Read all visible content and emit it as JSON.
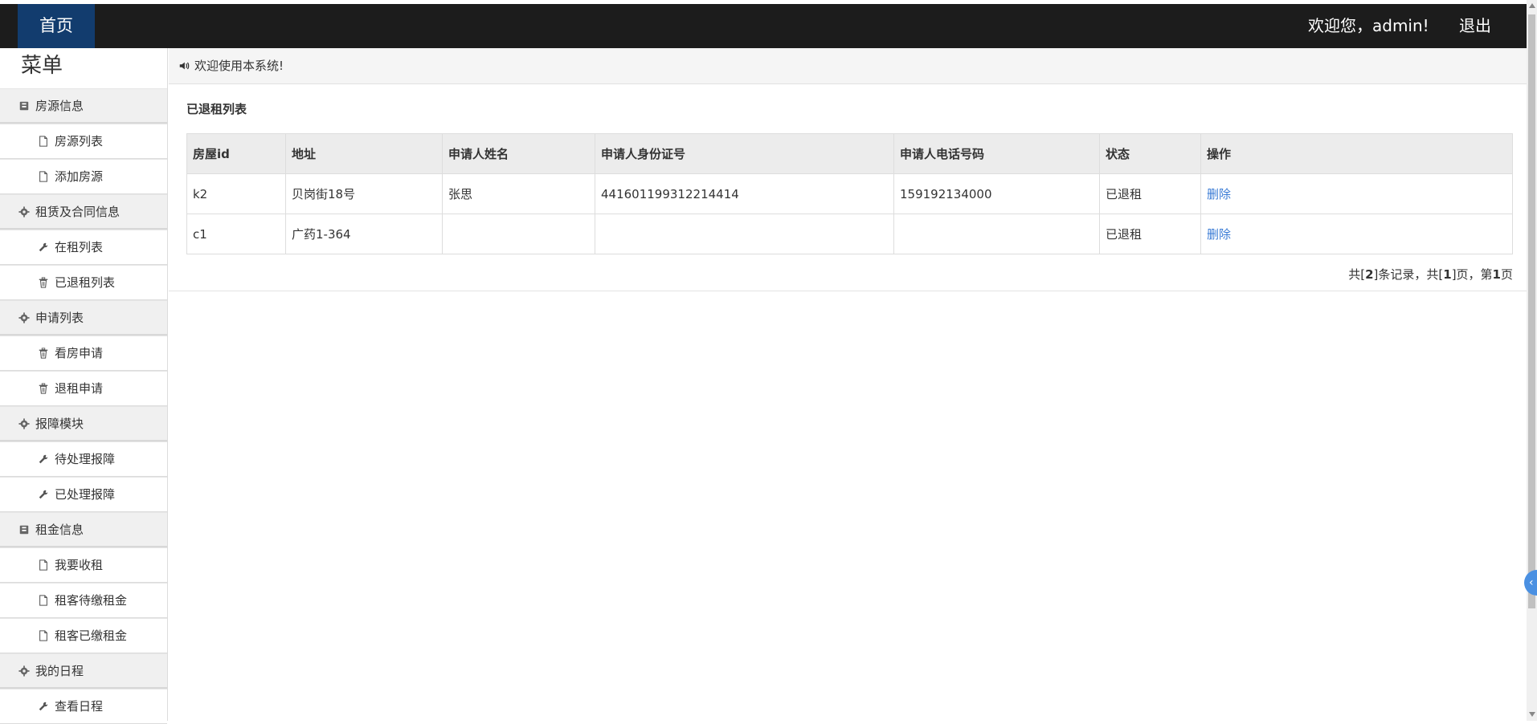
{
  "topbar": {
    "home_label": "首页",
    "welcome_text": "欢迎您，admin!",
    "logout_label": "退出"
  },
  "sidebar": {
    "title": "菜单",
    "items": [
      {
        "label": "房源信息",
        "kind": "group",
        "icon": "book-icon"
      },
      {
        "label": "房源列表",
        "kind": "sub",
        "icon": "file-icon"
      },
      {
        "label": "添加房源",
        "kind": "sub",
        "icon": "file-icon"
      },
      {
        "label": "租赁及合同信息",
        "kind": "group",
        "icon": "gear-icon"
      },
      {
        "label": "在租列表",
        "kind": "sub",
        "icon": "wrench-icon"
      },
      {
        "label": "已退租列表",
        "kind": "sub",
        "icon": "trash-icon"
      },
      {
        "label": "申请列表",
        "kind": "group",
        "icon": "gear-icon"
      },
      {
        "label": "看房申请",
        "kind": "sub",
        "icon": "trash-icon"
      },
      {
        "label": "退租申请",
        "kind": "sub",
        "icon": "trash-icon"
      },
      {
        "label": "报障模块",
        "kind": "group",
        "icon": "gear-icon"
      },
      {
        "label": "待处理报障",
        "kind": "sub",
        "icon": "wrench-icon"
      },
      {
        "label": "已处理报障",
        "kind": "sub",
        "icon": "wrench-icon"
      },
      {
        "label": "租金信息",
        "kind": "group",
        "icon": "book-icon"
      },
      {
        "label": "我要收租",
        "kind": "sub",
        "icon": "file-icon"
      },
      {
        "label": "租客待缴租金",
        "kind": "sub",
        "icon": "file-icon"
      },
      {
        "label": "租客已缴租金",
        "kind": "sub",
        "icon": "file-icon"
      },
      {
        "label": "我的日程",
        "kind": "group",
        "icon": "gear-icon"
      },
      {
        "label": "查看日程",
        "kind": "sub",
        "icon": "wrench-icon"
      }
    ]
  },
  "notice": {
    "icon": "speaker-icon",
    "text": "欢迎使用本系统!"
  },
  "panel": {
    "title": "已退租列表",
    "columns": [
      "房屋id",
      "地址",
      "申请人姓名",
      "申请人身份证号",
      "申请人电话号码",
      "状态",
      "操作"
    ],
    "rows": [
      [
        "k2",
        "贝岗街18号",
        "张思",
        "441601199312214414",
        "159192134000",
        "已退租",
        "删除"
      ],
      [
        "c1",
        "广药1-364",
        "",
        "",
        "",
        "已退租",
        "删除"
      ]
    ],
    "pager": {
      "prefix": "共[",
      "total_records": "2",
      "mid1": "]条记录，共[",
      "total_pages": "1",
      "mid2": "]页，第",
      "current_page": "1",
      "suffix": "页"
    }
  },
  "floating_button": {
    "icon": "chevron-left-icon",
    "glyph": "‹"
  },
  "colors": {
    "topbar": "#1c1c1c",
    "home_active": "#123c6e",
    "link": "#3a7bd5"
  }
}
